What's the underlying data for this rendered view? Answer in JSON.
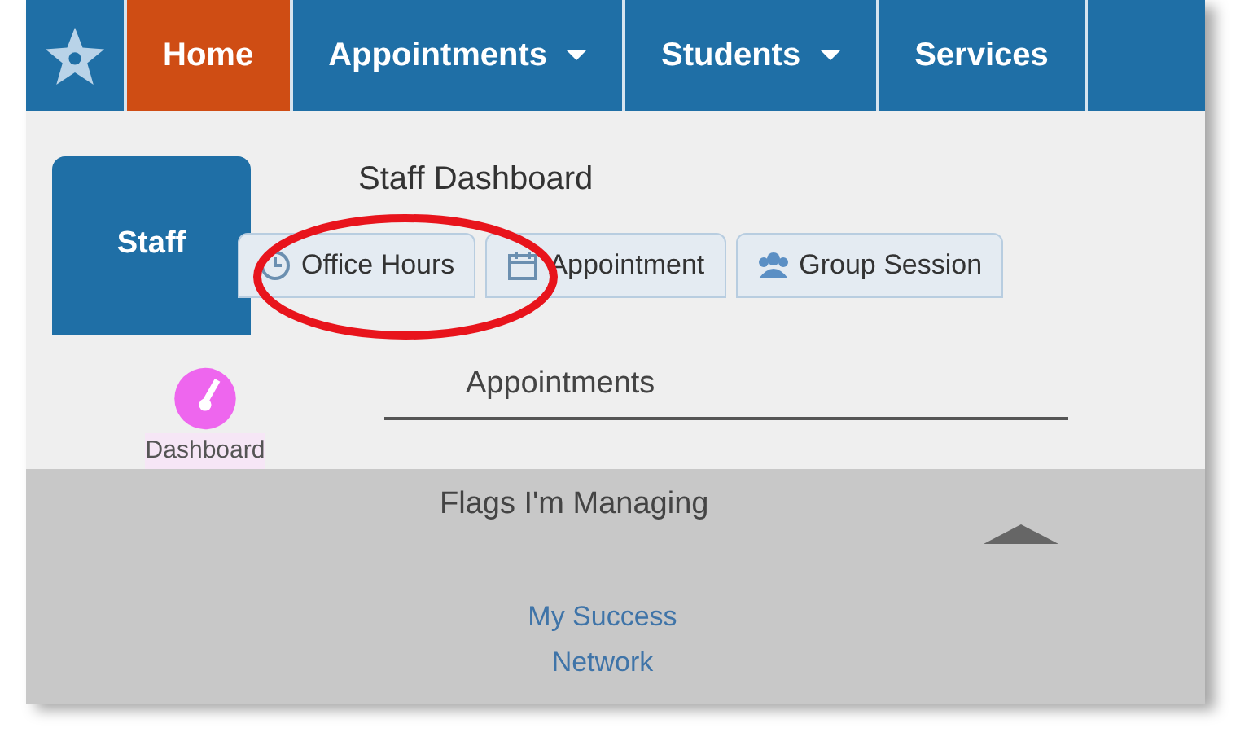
{
  "nav": {
    "items": [
      {
        "label": "Home",
        "selected": true,
        "dropdown": false
      },
      {
        "label": "Appointments",
        "selected": false,
        "dropdown": true
      },
      {
        "label": "Students",
        "selected": false,
        "dropdown": true
      },
      {
        "label": "Services",
        "selected": false,
        "dropdown": false
      }
    ]
  },
  "role_tab": {
    "label": "Staff"
  },
  "page_title": "Staff Dashboard",
  "actions": [
    {
      "label": "Office Hours",
      "kind": "clock"
    },
    {
      "label": "Appointment",
      "kind": "calendar"
    },
    {
      "label": "Group Session",
      "kind": "group"
    }
  ],
  "sidebar": {
    "label": "Dashboard"
  },
  "sections": [
    {
      "title": "Appointments"
    },
    {
      "title": "Flags I'm Managing"
    }
  ],
  "network_link": "My Success Network"
}
